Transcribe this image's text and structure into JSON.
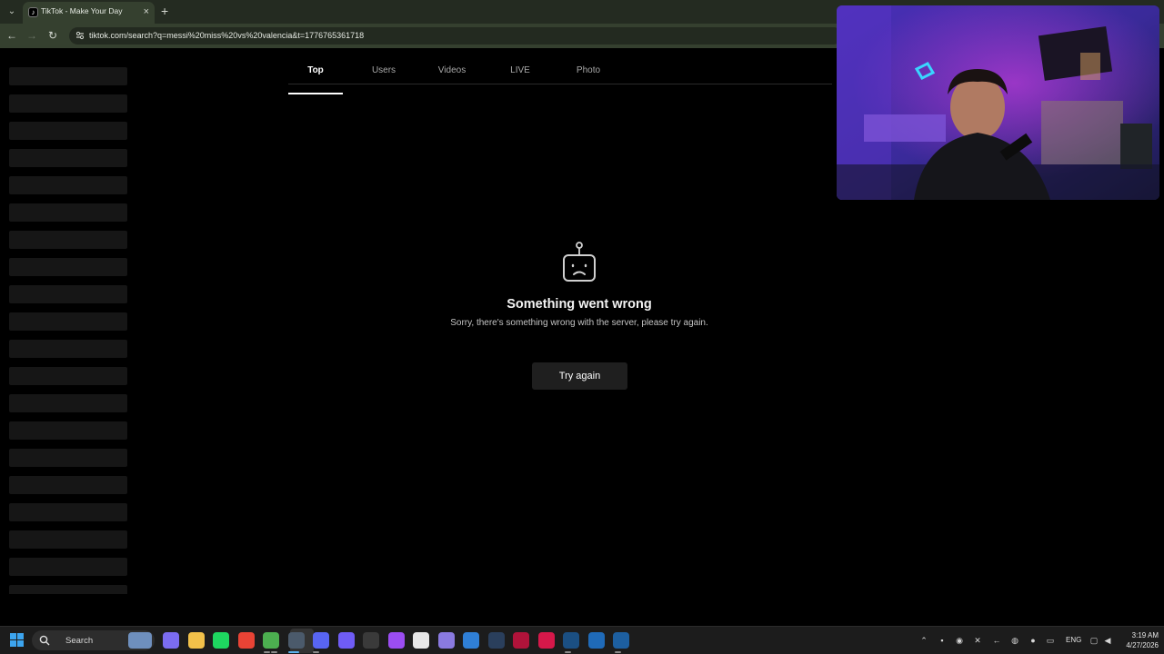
{
  "browser": {
    "tab_title": "TikTok - Make Your Day",
    "tab_close": "×",
    "new_tab": "+",
    "tab_menu": "⌄",
    "back": "←",
    "forward": "→",
    "reload": "↻",
    "url": "tiktok.com/search?q=messi%20miss%20vs%20valencia&t=1776765361718"
  },
  "search_tabs": [
    {
      "label": "Top",
      "active": true
    },
    {
      "label": "Users",
      "active": false
    },
    {
      "label": "Videos",
      "active": false
    },
    {
      "label": "LIVE",
      "active": false
    },
    {
      "label": "Photo",
      "active": false
    }
  ],
  "error": {
    "icon": "sad-robot-icon",
    "title": "Something went wrong",
    "message": "Sorry, there's something wrong with the server, please try again.",
    "retry_label": "Try again"
  },
  "sidebar_skeleton_rows": 20,
  "taskbar": {
    "search_label": "Search",
    "language": "ENG",
    "time": "3:19 AM",
    "date": "4/27/2026",
    "apps": [
      {
        "name": "copilot-icon",
        "color": "#7b6cf0"
      },
      {
        "name": "file-explorer-icon",
        "color": "#f2c14a"
      },
      {
        "name": "spotify-icon",
        "color": "#1ed760"
      },
      {
        "name": "chrome-icon",
        "color": "#e84335"
      },
      {
        "name": "chrome-alt-icon",
        "color": "#4caf50"
      },
      {
        "name": "steam-client-icon",
        "color": "#4b5a6b"
      },
      {
        "name": "discord-icon",
        "color": "#5865f2"
      },
      {
        "name": "app-grid-icon",
        "color": "#6f5cf5"
      },
      {
        "name": "keyboard-app-icon",
        "color": "#3a3a3a"
      },
      {
        "name": "purple-app-icon",
        "color": "#9b4df2"
      },
      {
        "name": "store-icon",
        "color": "#e8e8e8"
      },
      {
        "name": "gamepad-icon",
        "color": "#8a7ae0"
      },
      {
        "name": "remote-app-icon",
        "color": "#2f7fd6"
      },
      {
        "name": "4k-app-icon",
        "color": "#2a3f5c"
      },
      {
        "name": "v-app-icon",
        "color": "#b0133a"
      },
      {
        "name": "a-app-icon",
        "color": "#d6184a"
      },
      {
        "name": "steam-icon",
        "color": "#1b4f82"
      },
      {
        "name": "blue-app-icon",
        "color": "#1f6ab8"
      },
      {
        "name": "steam-running-icon",
        "color": "#1d5fa0"
      }
    ]
  },
  "colors": {
    "tabbar": "#242b21",
    "toolbar": "#35402f",
    "page_bg": "#000000",
    "taskbar": "#1c1c1c",
    "accent_blue": "#3ca4ee"
  }
}
